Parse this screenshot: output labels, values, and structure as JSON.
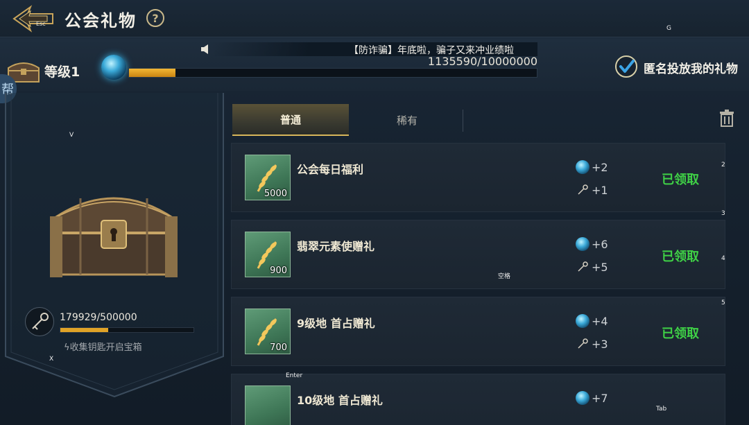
{
  "header": {
    "title": "公会礼物",
    "esc_hint": "Esc",
    "help_label": "?",
    "g_hint": "G"
  },
  "level": {
    "label": "等级1",
    "xp_current_text": "1135590/10000000",
    "xp_fraction": 0.1136,
    "notice": "【防诈骗】年底啦，骗子又来冲业绩啦"
  },
  "anonymous": {
    "label": "匿名投放我的礼物",
    "checked": true
  },
  "side_tab": {
    "label": "帮"
  },
  "chest_panel": {
    "v_hint": "V",
    "x_hint": "X",
    "key_count": "179929/500000",
    "key_fraction": 0.36,
    "hint": "收集钥匙开启宝箱"
  },
  "tabs": [
    {
      "label": "普通",
      "active": true
    },
    {
      "label": "稀有",
      "active": false
    }
  ],
  "gifts": [
    {
      "name": "公会每日福利",
      "qty": "5000",
      "orb": "+2",
      "key": "+1",
      "status": "已领取",
      "hint_a": "2",
      "hint_b": "3"
    },
    {
      "name": "翡翠元素使赠礼",
      "qty": "900",
      "orb": "+6",
      "key": "+5",
      "status": "已领取",
      "hint_a": "4",
      "hint_b": ""
    },
    {
      "name": "9级地 首占赠礼",
      "qty": "700",
      "orb": "+4",
      "key": "+3",
      "status": "已领取",
      "hint_a": "5",
      "hint_b": ""
    },
    {
      "name": "10级地 首占赠礼",
      "qty": "",
      "orb": "+7",
      "key": "",
      "status": "",
      "hint_a": "",
      "hint_b": ""
    }
  ],
  "key_hints": {
    "space": "空格",
    "enter": "Enter",
    "tab": "Tab"
  },
  "colors": {
    "accent_gold": "#e0a327",
    "claimed_green": "#3fd146",
    "item_icon_green": "#4a8563"
  },
  "icons": {
    "back": "back-arrow-icon",
    "help": "question-icon",
    "speaker": "speaker-icon",
    "check": "checkmark-icon",
    "trash": "trash-icon",
    "orb": "orb-icon",
    "key": "key-icon",
    "wheat": "wheat-icon",
    "chest": "treasure-chest-icon"
  }
}
